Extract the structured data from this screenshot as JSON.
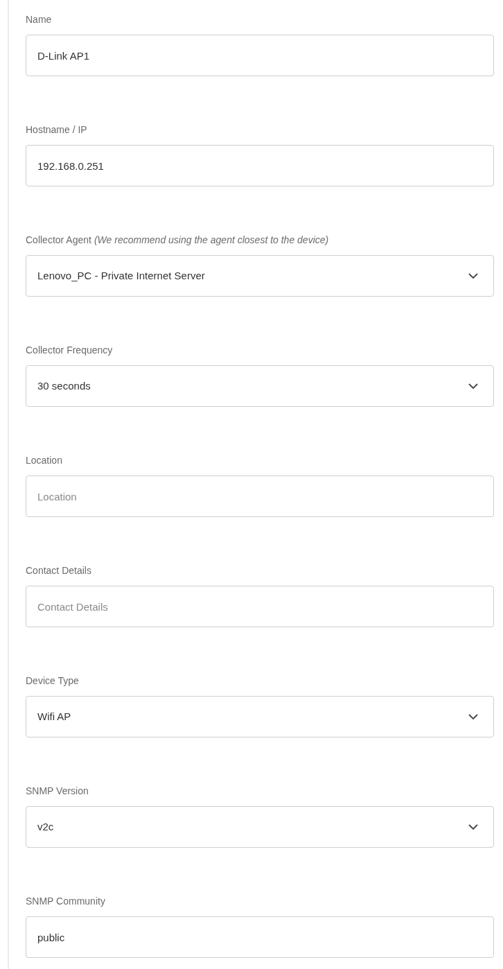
{
  "fields": [
    {
      "kind": "text",
      "label": "Name",
      "value": "D-Link AP1"
    },
    {
      "kind": "text",
      "label": "Hostname / IP",
      "value": "192.168.0.251"
    },
    {
      "kind": "select",
      "label": "Collector Agent",
      "hint": "(We recommend using the agent closest to the device)",
      "value": "Lenovo_PC - Private Internet Server"
    },
    {
      "kind": "select",
      "label": "Collector Frequency",
      "value": "30 seconds"
    },
    {
      "kind": "text",
      "label": "Location",
      "placeholder": "Location"
    },
    {
      "kind": "text",
      "label": "Contact Details",
      "placeholder": "Contact Details"
    },
    {
      "kind": "select",
      "label": "Device Type",
      "value": "Wifi AP"
    },
    {
      "kind": "select",
      "label": "SNMP Version",
      "value": "v2c"
    },
    {
      "kind": "text",
      "label": "SNMP Community",
      "value": "public"
    }
  ]
}
